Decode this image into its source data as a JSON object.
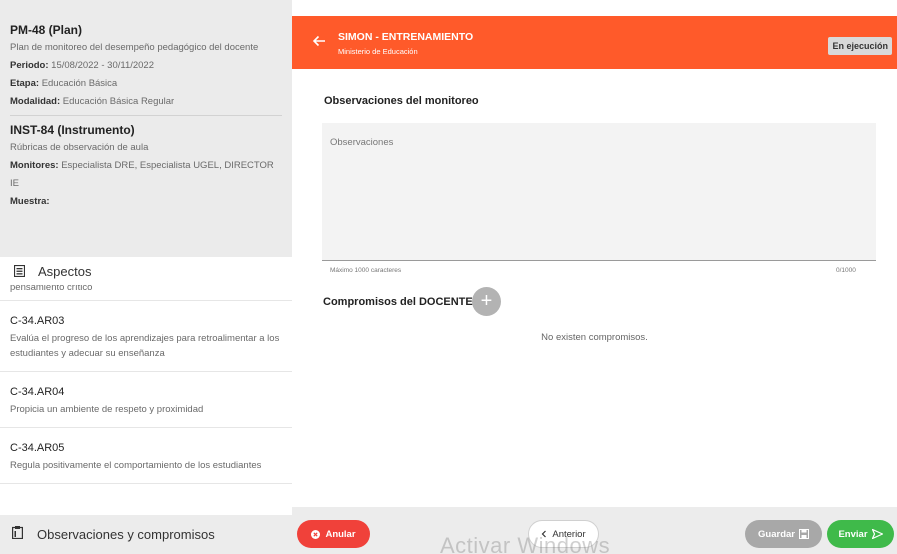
{
  "plan": {
    "code": "PM-48 (Plan)",
    "name": "Plan de monitoreo del desempeño pedagógico del docente",
    "periodo_label": "Periodo:",
    "periodo_value": "15/08/2022 - 30/11/2022",
    "etapa_label": "Etapa:",
    "etapa_value": "Educación Básica",
    "modalidad_label": "Modalidad:",
    "modalidad_value": "Educación Básica Regular"
  },
  "instrument": {
    "code": "INST-84 (Instrumento)",
    "name": "Rúbricas de observación de aula",
    "monitores_label": "Monitores:",
    "monitores_value": "Especialista DRE, Especialista UGEL, DIRECTOR IE",
    "muestra_label": "Muestra:"
  },
  "aspects": {
    "header": "Aspectos",
    "icon": "list-icon",
    "partial_text": "pensamiento crítico",
    "items": [
      {
        "code": "C-34.AR03",
        "desc": "Evalúa el progreso de los aprendizajes para retroalimentar a los estudiantes y adecuar su enseñanza"
      },
      {
        "code": "C-34.AR04",
        "desc": "Propicia un ambiente de respeto y proximidad"
      },
      {
        "code": "C-34.AR05",
        "desc": "Regula positivamente el comportamiento de los estudiantes"
      }
    ]
  },
  "obs_nav": {
    "label": "Observaciones y compromisos",
    "icon": "clipboard-icon"
  },
  "header": {
    "title": "SIMON - ENTRENAMIENTO",
    "subtitle": "Ministerio de Educación",
    "status": "En ejecución",
    "back_icon": "arrow-left-icon",
    "color": "#ff5a2a"
  },
  "observations": {
    "title": "Observaciones del monitoreo",
    "placeholder": "Observaciones",
    "value": "",
    "hint": "Máximo 1000 caracteres",
    "counter": "0/1000"
  },
  "commitments": {
    "title": "Compromisos del DOCENTE",
    "add_icon": "plus-icon",
    "empty": "No existen compromisos."
  },
  "footer": {
    "anular": "Anular",
    "anterior": "Anterior",
    "guardar": "Guardar",
    "enviar": "Enviar",
    "anular_color": "#f0413a",
    "enviar_color": "#3fba4a"
  },
  "watermark": "Activar Windows"
}
